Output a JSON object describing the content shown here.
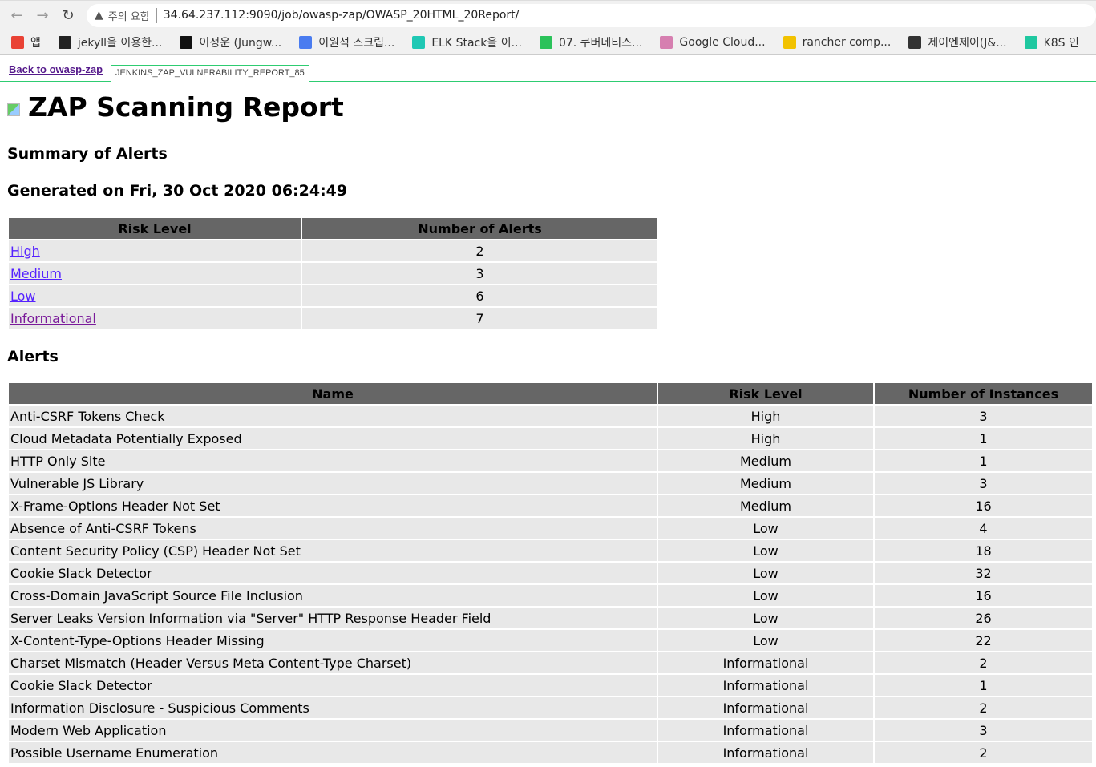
{
  "browser": {
    "security_label": "주의 요함",
    "url": "34.64.237.112:9090/job/owasp-zap/OWASP_20HTML_20Report/"
  },
  "bookmarks": [
    {
      "label": "앱",
      "color": "#e94235"
    },
    {
      "label": "jekyll을 이용한...",
      "color": "#222222"
    },
    {
      "label": "이정운 (Jungw...",
      "color": "#111111"
    },
    {
      "label": "이원석 스크립...",
      "color": "#4a7cf0"
    },
    {
      "label": "ELK Stack을 이...",
      "color": "#1fc8b4"
    },
    {
      "label": "07. 쿠버네티스...",
      "color": "#2bc25a"
    },
    {
      "label": "Google Cloud...",
      "color": "#d67fb0"
    },
    {
      "label": "rancher comp...",
      "color": "#f2c200"
    },
    {
      "label": "제이엔제이(J&...",
      "color": "#333333"
    },
    {
      "label": "K8S 인",
      "color": "#1fc8a0"
    }
  ],
  "jenkins": {
    "back_link": "Back to owasp-zap",
    "tab": "JENKINS_ZAP_VULNERABILITY_REPORT_85"
  },
  "report": {
    "title": "ZAP Scanning Report",
    "summary_heading": "Summary of Alerts",
    "generated": "Generated on Fri, 30 Oct 2020 06:24:49",
    "alerts_heading": "Alerts"
  },
  "summary": {
    "headers": [
      "Risk Level",
      "Number of Alerts"
    ],
    "rows": [
      {
        "level": "High",
        "count": "2"
      },
      {
        "level": "Medium",
        "count": "3"
      },
      {
        "level": "Low",
        "count": "6"
      },
      {
        "level": "Informational",
        "count": "7"
      }
    ]
  },
  "alerts": {
    "headers": [
      "Name",
      "Risk Level",
      "Number of Instances"
    ],
    "rows": [
      {
        "name": "Anti-CSRF Tokens Check",
        "risk": "High",
        "n": "3"
      },
      {
        "name": "Cloud Metadata Potentially Exposed",
        "risk": "High",
        "n": "1"
      },
      {
        "name": "HTTP Only Site",
        "risk": "Medium",
        "n": "1"
      },
      {
        "name": "Vulnerable JS Library",
        "risk": "Medium",
        "n": "3"
      },
      {
        "name": "X-Frame-Options Header Not Set",
        "risk": "Medium",
        "n": "16"
      },
      {
        "name": "Absence of Anti-CSRF Tokens",
        "risk": "Low",
        "n": "4"
      },
      {
        "name": "Content Security Policy (CSP) Header Not Set",
        "risk": "Low",
        "n": "18"
      },
      {
        "name": "Cookie Slack Detector",
        "risk": "Low",
        "n": "32"
      },
      {
        "name": "Cross-Domain JavaScript Source File Inclusion",
        "risk": "Low",
        "n": "16"
      },
      {
        "name": "Server Leaks Version Information via \"Server\" HTTP Response Header Field",
        "risk": "Low",
        "n": "26"
      },
      {
        "name": "X-Content-Type-Options Header Missing",
        "risk": "Low",
        "n": "22"
      },
      {
        "name": "Charset Mismatch (Header Versus Meta Content-Type Charset)",
        "risk": "Informational",
        "n": "2"
      },
      {
        "name": "Cookie Slack Detector",
        "risk": "Informational",
        "n": "1"
      },
      {
        "name": "Information Disclosure - Suspicious Comments",
        "risk": "Informational",
        "n": "2"
      },
      {
        "name": "Modern Web Application",
        "risk": "Informational",
        "n": "3"
      },
      {
        "name": "Possible Username Enumeration",
        "risk": "Informational",
        "n": "2"
      }
    ]
  }
}
